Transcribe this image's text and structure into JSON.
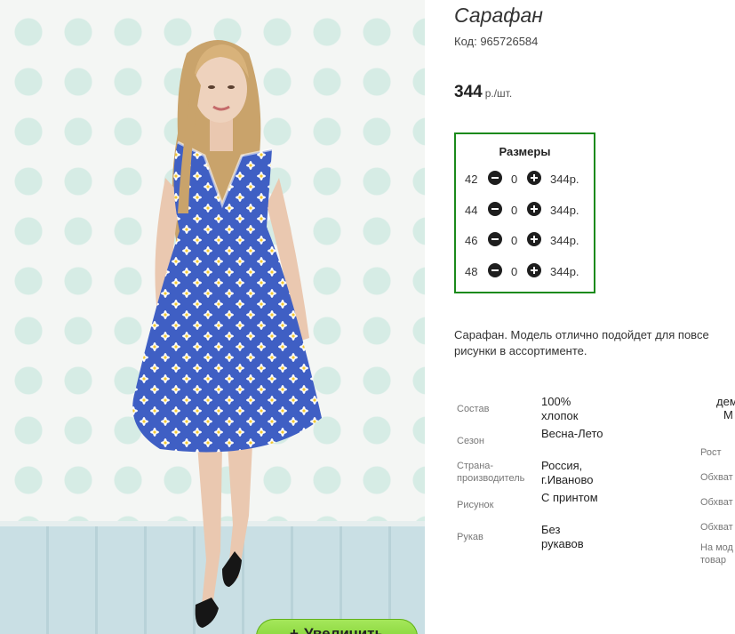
{
  "product": {
    "title": "Сарафан",
    "code": "Код: 965726584",
    "price": "344",
    "price_unit": "р./шт."
  },
  "sizes": {
    "heading": "Размеры",
    "rows": [
      {
        "size": "42",
        "qty": "0",
        "price": "344р."
      },
      {
        "size": "44",
        "qty": "0",
        "price": "344р."
      },
      {
        "size": "46",
        "qty": "0",
        "price": "344р."
      },
      {
        "size": "48",
        "qty": "0",
        "price": "344р."
      }
    ]
  },
  "description": {
    "line1": "Сарафан. Модель отлично подойдет для повсе",
    "line2": "рисунки в ассортименте."
  },
  "specs": [
    {
      "label": "Состав",
      "value": "100% хлопок"
    },
    {
      "label": "Сезон",
      "value": "Весна-Лето"
    },
    {
      "label": "Страна-производитель",
      "value": "Россия, г.Иваново"
    },
    {
      "label": "Рисунок",
      "value": "С принтом"
    },
    {
      "label": "Рукав",
      "value": "Без рукавов"
    }
  ],
  "specs_right": {
    "value_top1": "дем",
    "value_top2": "М",
    "labels": [
      "Рост",
      "Обхват",
      "Обхват",
      "Обхват",
      "На мод",
      "товар"
    ]
  },
  "zoom_button": {
    "icon": "+",
    "label": "Увеличить"
  },
  "colors": {
    "accent_border": "#1b8a1b",
    "zoom_green": "#7ccf2c",
    "dress_blue": "#3f5fc4"
  }
}
